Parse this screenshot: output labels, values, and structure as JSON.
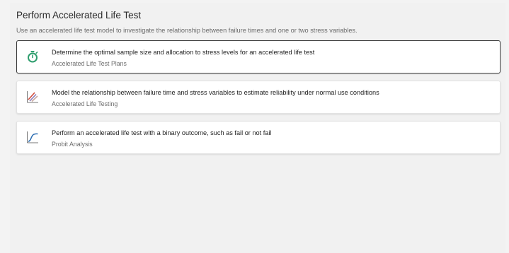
{
  "page": {
    "title": "Perform Accelerated Life Test",
    "subtitle": "Use an accelerated life test model to investigate the relationship between failure times and one or two stress variables."
  },
  "options": [
    {
      "title": "Determine the optimal sample size and allocation to stress levels for an accelerated life test",
      "subtitle": "Accelerated Life Test Plans",
      "icon": "stopwatch-icon",
      "selected": true
    },
    {
      "title": "Model the relationship between failure time and stress variables to estimate reliability under normal use conditions",
      "subtitle": "Accelerated Life Testing",
      "icon": "stress-lines-icon",
      "selected": false
    },
    {
      "title": "Perform an accelerated life test with a binary outcome, such as fail or not fail",
      "subtitle": "Probit Analysis",
      "icon": "probit-curve-icon",
      "selected": false
    }
  ],
  "colors": {
    "accent_green": "#2f9e6e",
    "accent_red": "#d04a3a",
    "accent_purple": "#8a7bb8",
    "accent_blue": "#2d6fb3",
    "selected_border": "#3a3a3a"
  }
}
